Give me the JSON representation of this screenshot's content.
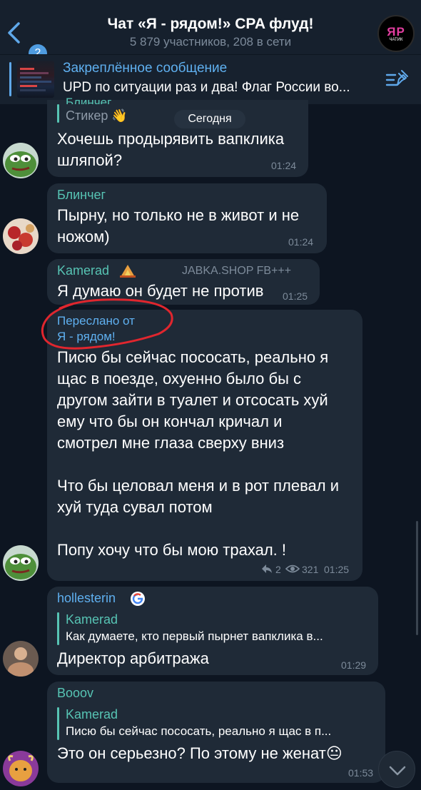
{
  "header": {
    "back_count": "2",
    "title": "Чат «Я - рядом!» CPA флуд!",
    "subtitle": "5 879 участников, 208 в сети",
    "avatar_text": "ЯР",
    "avatar_sub": "ЧАТИК"
  },
  "pinned": {
    "title": "Закреплённое сообщение",
    "text": "UPD по ситуации раз и два! Флаг России во..."
  },
  "day_label": "Сегодня",
  "messages": [
    {
      "quote_name": "Блинчег",
      "quote_text": "Стикер 👋",
      "text": "Хочешь продырявить вапклика шляпой?",
      "time": "01:24"
    },
    {
      "name": "Блинчег",
      "text": "Пырну, но только не в живот и не ножом)",
      "time": "01:24"
    },
    {
      "name": "Kamerad",
      "title": "JABKA.SHOP FB+++",
      "text": "Я думаю он будет не против",
      "time": "01:25"
    },
    {
      "forward_label": "Переслано от",
      "forward_from": "Я - рядом!",
      "text_lines": [
        "Писю бы сейчас пососать, реально я",
        "щас в поезде, охуенно было бы с",
        "другом зайти в туалет и отсосать хуй",
        "ему что бы он кончал кричал и",
        "смотрел мне глаза сверху вниз",
        "",
        "Что бы целовал меня и в рот плевал и",
        "хуй туда сувал потом",
        "",
        "Попу хочу что бы мою трахал.  !"
      ],
      "replies": "2",
      "views": "321",
      "time": "01:25"
    },
    {
      "name": "hollesterin",
      "quote_name": "Kamerad",
      "quote_text": "Как думаете, кто первый пырнет вапклика в...",
      "text": "Директор арбитража",
      "time": "01:29"
    },
    {
      "name": "Booov",
      "quote_name": "Kamerad",
      "quote_text": "Писю бы сейчас пососать, реально я щас в п...",
      "text": "Это он серьезно? По этому не женат😐",
      "time": "01:53"
    }
  ],
  "colors": {
    "background": "#0d1521",
    "bubble": "#1f2a37",
    "accent": "#5fb0f0",
    "name_teal": "#57c4b4",
    "name_orange": "#e58a52",
    "annotation_red": "#e0262e"
  }
}
